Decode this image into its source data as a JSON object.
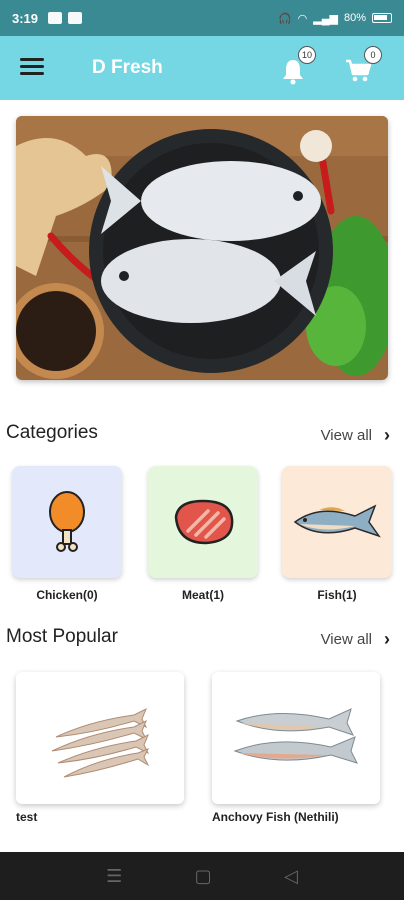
{
  "status_bar": {
    "time": "3:19",
    "battery": "80%"
  },
  "app_bar": {
    "title": "D Fresh",
    "notification_count": "10",
    "cart_count": "0"
  },
  "categories": {
    "title": "Categories",
    "view_all": "View all",
    "items": [
      {
        "label": "Chicken(0)",
        "bg": "#e3e8fb",
        "icon": "chicken-leg-icon"
      },
      {
        "label": "Meat(1)",
        "bg": "#e4f7dc",
        "icon": "steak-icon"
      },
      {
        "label": "Fish(1)",
        "bg": "#fde9d7",
        "icon": "fish-icon"
      }
    ]
  },
  "popular": {
    "title": "Most Popular",
    "view_all": "View all",
    "items": [
      {
        "label": "test"
      },
      {
        "label": "Anchovy Fish (Nethili)"
      }
    ]
  },
  "colors": {
    "status_bar": "#3a8a94",
    "app_bar": "#76d7e4"
  }
}
